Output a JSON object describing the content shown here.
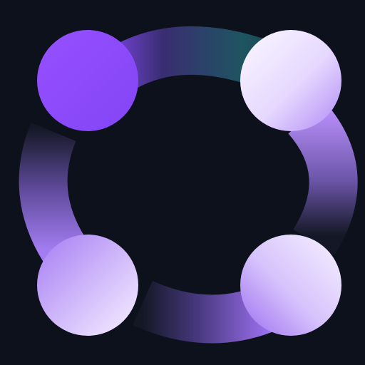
{
  "logo": {
    "name": "four-node-ring-logo",
    "colors": {
      "background": "#0d111c",
      "purple": "#8a4dff",
      "lavender": "#c9a9ff",
      "lilac": "#a27cf0",
      "white_lavender": "#f4eeff",
      "dark_teal": "#163f4e",
      "teal": "#1e5560"
    }
  }
}
